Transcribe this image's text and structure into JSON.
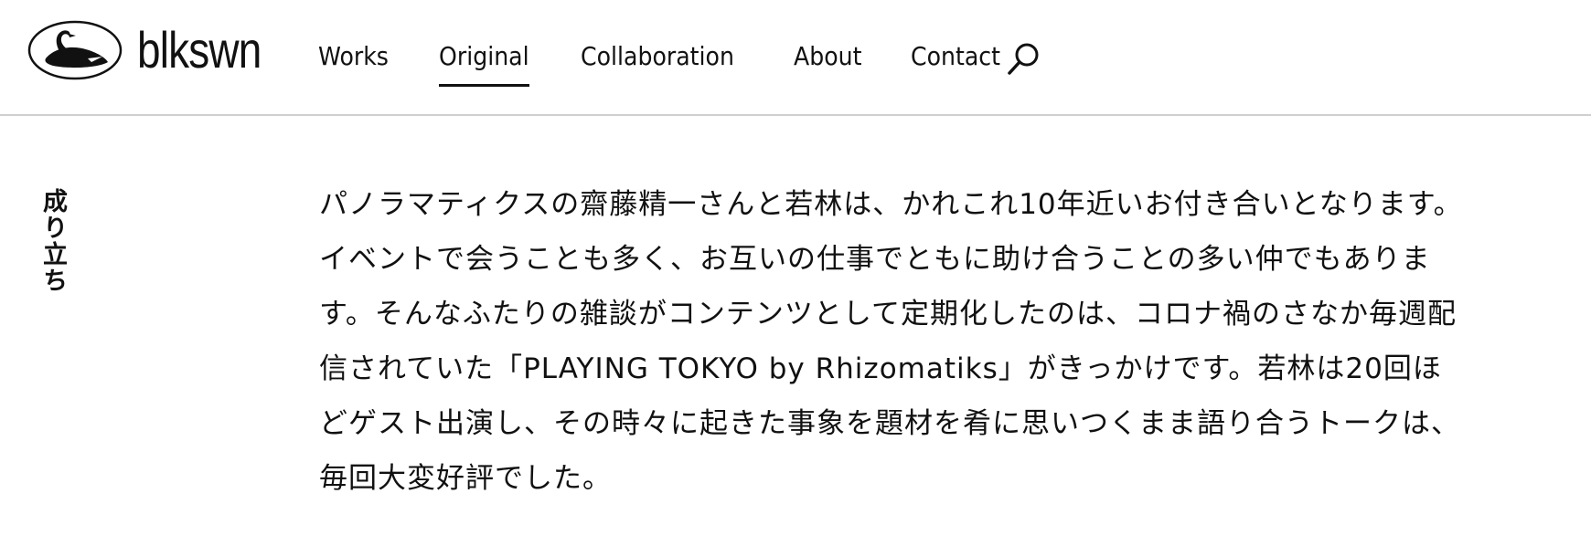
{
  "header": {
    "logo_text": "blkswn",
    "nav": [
      {
        "label": "Works"
      },
      {
        "label": "Original",
        "active": true
      },
      {
        "label": "Collaboration"
      },
      {
        "label": "About"
      },
      {
        "label": "Contact"
      }
    ],
    "search_icon": "search-icon"
  },
  "main": {
    "section_label": "成り立ち",
    "paragraph": "パノラマティクスの齋藤精一さんと若林は、かれこれ10年近いお付き合いとなります。イベントで会うことも多く、お互いの仕事でともに助け合うことの多い仲でもあります。そんなふたりの雑談がコンテンツとして定期化したのは、コロナ禍のさなか毎週配信されていた「PLAYING TOKYO by Rhizomatiks」がきっかけです。若林は20回ほどゲスト出演し、その時々に起きた事象を題材を肴に思いつくまま語り合うトークは、毎回大変好評でした。"
  }
}
